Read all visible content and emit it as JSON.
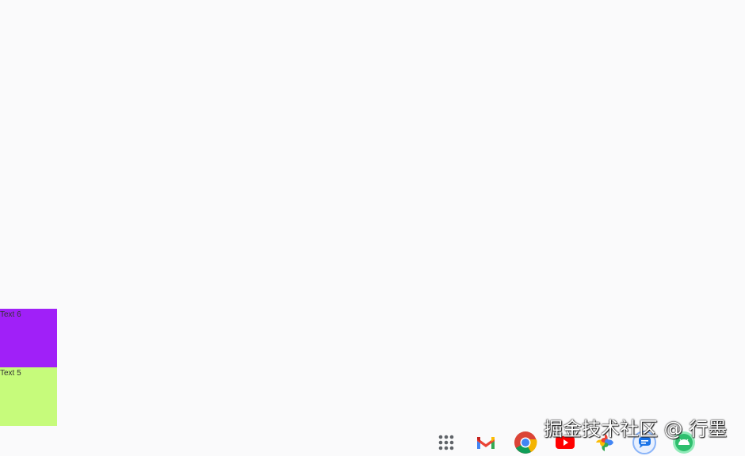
{
  "boxes": [
    {
      "label": "Text 6",
      "color": "#a020f8"
    },
    {
      "label": "Text 5",
      "color": "#c6fb7b"
    }
  ],
  "taskbar": {
    "apps": [
      {
        "name": "app-launcher-icon"
      },
      {
        "name": "gmail-icon"
      },
      {
        "name": "chrome-icon"
      },
      {
        "name": "youtube-icon"
      },
      {
        "name": "google-photos-icon"
      },
      {
        "name": "messages-icon"
      },
      {
        "name": "android-icon"
      }
    ]
  },
  "watermark": "掘金技术社区 @ 行墨"
}
